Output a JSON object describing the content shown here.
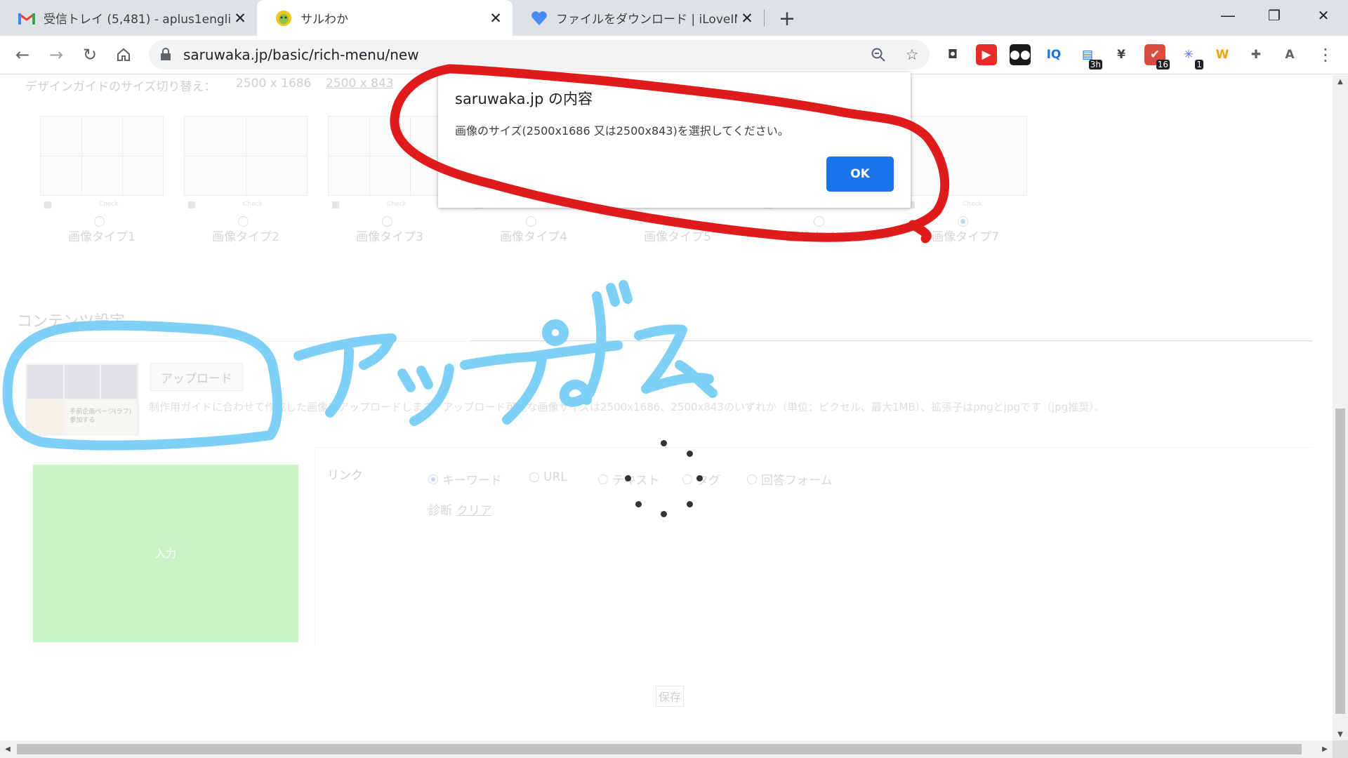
{
  "browser": {
    "tabs": [
      {
        "title": "受信トレイ (5,481) - aplus1english",
        "favicon": "gmail-icon"
      },
      {
        "title": "サルわか",
        "favicon": "saruwaka-icon"
      },
      {
        "title": "ファイルをダウンロード | iLoveIMG",
        "favicon": "ilovimg-icon"
      }
    ],
    "active_tab": 1,
    "url_host": "saruwaka.jp",
    "url_path": "/basic/rich-menu/new",
    "extensions": [
      {
        "name": "screen-capture-icon",
        "glyph": "◘",
        "color": "#3c4043",
        "bg": "transparent"
      },
      {
        "name": "youtube-icon",
        "glyph": "▶",
        "color": "#ffffff",
        "bg": "#e52d27"
      },
      {
        "name": "dots-icon",
        "glyph": "●●",
        "color": "#ffffff",
        "bg": "#1a1a1a"
      },
      {
        "name": "iq-icon",
        "glyph": "IQ",
        "color": "#1a73e8",
        "bg": "transparent"
      },
      {
        "name": "calendar-icon",
        "glyph": "▤",
        "color": "#1a73e8",
        "bg": "transparent",
        "badge": "3h"
      },
      {
        "name": "yen-icon",
        "glyph": "¥",
        "color": "#3c4043",
        "bg": "transparent"
      },
      {
        "name": "todo-icon",
        "glyph": "✔",
        "color": "#ffffff",
        "bg": "#db4c3f",
        "badge": "16"
      },
      {
        "name": "burst-icon",
        "glyph": "✳",
        "color": "#5b6ee1",
        "bg": "transparent",
        "badge": "1"
      },
      {
        "name": "w-icon",
        "glyph": "W",
        "color": "#f0a30a",
        "bg": "transparent"
      },
      {
        "name": "puzzle-icon",
        "glyph": "✚",
        "color": "#5f6368",
        "bg": "transparent"
      },
      {
        "name": "profile-avatar-icon",
        "glyph": "A",
        "color": "#5f6368",
        "bg": "transparent"
      }
    ]
  },
  "page": {
    "guide": {
      "label": "デザインガイドのサイズ切り替え：",
      "size_a": "2500 x 1686",
      "size_b": "2500 x 843"
    },
    "image_types": [
      {
        "name": "画像タイプ1",
        "layout": "2x3",
        "selected": false
      },
      {
        "name": "画像タイプ2",
        "layout": "2x2",
        "selected": false
      },
      {
        "name": "画像タイプ3",
        "layout": "2x3",
        "selected": false
      },
      {
        "name": "画像タイプ4",
        "layout": "2x2",
        "selected": false
      },
      {
        "name": "画像タイプ5",
        "layout": "2x2",
        "selected": false
      },
      {
        "name": "画像タイプ6",
        "layout": "2x2",
        "selected": false
      },
      {
        "name": "画像タイプ7",
        "layout": "1x1",
        "selected": true
      }
    ],
    "check_label": "Check",
    "contents_title": "コンテンツ設定",
    "preview_caption": "手前企画ページ(ラフ)\n参加する",
    "upload_button": "アップロード",
    "upload_help": "制作用ガイドに合わせて作成した画像をアップロードします。アップロード可能な画像サイズは2500x1686、2500x843のいずれか（単位：ピクセル、最大1MB）、拡張子はpngとjpgです（jpg推奨）。",
    "area_label": "入力",
    "link_label": "リンク",
    "link_options": [
      {
        "label": "キーワード",
        "selected": true
      },
      {
        "label": "URL",
        "selected": false
      },
      {
        "label": "テキスト",
        "selected": false
      },
      {
        "label": "タグ",
        "selected": false
      },
      {
        "label": "回答フォーム",
        "selected": false
      }
    ],
    "diagnosis_label": "診断",
    "clear_link": "クリア",
    "save_button": "保存"
  },
  "dialog": {
    "title": "saruwaka.jp の内容",
    "message": "画像のサイズ(2500x1686 又は2500x843)を選択してください。",
    "ok": "OK"
  },
  "annotations": {
    "handwritten_text": "アップずみ",
    "red_ink": "#e01b1b",
    "blue_ink": "#7fd0f7"
  }
}
